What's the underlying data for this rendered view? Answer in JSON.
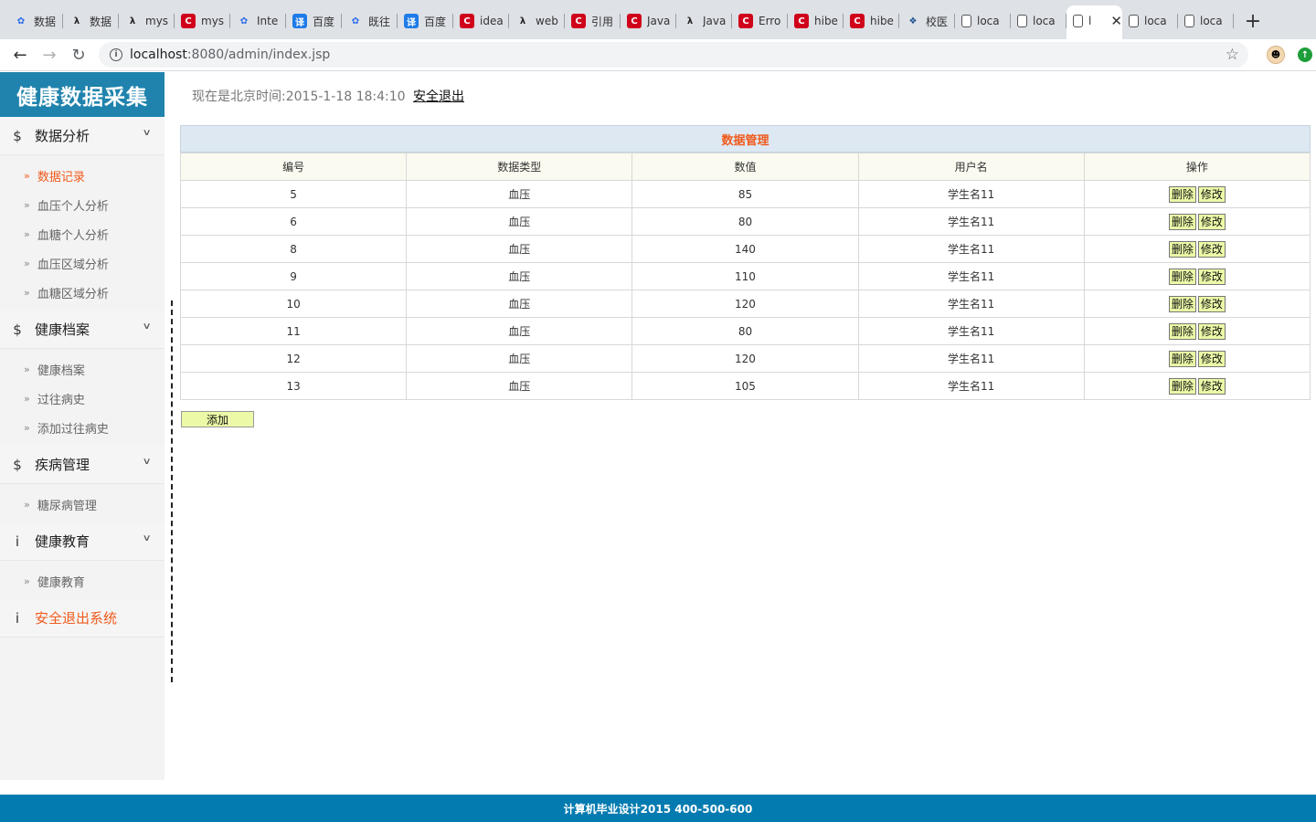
{
  "browser": {
    "tabs": [
      {
        "icon": "paw-icon",
        "title": "数据"
      },
      {
        "icon": "lambda-icon",
        "title": "数据"
      },
      {
        "icon": "lambda-icon",
        "title": "mys"
      },
      {
        "icon": "csdn-icon",
        "title": "mys"
      },
      {
        "icon": "paw-icon",
        "title": "Inte"
      },
      {
        "icon": "translate-icon",
        "title": "百度"
      },
      {
        "icon": "paw-icon",
        "title": "既往"
      },
      {
        "icon": "translate-icon",
        "title": "百度"
      },
      {
        "icon": "csdn-icon",
        "title": "idea"
      },
      {
        "icon": "lambda-icon",
        "title": "web"
      },
      {
        "icon": "csdn-icon",
        "title": "引用"
      },
      {
        "icon": "csdn-icon",
        "title": "Java"
      },
      {
        "icon": "lambda-icon",
        "title": "Java"
      },
      {
        "icon": "csdn-icon",
        "title": "Erro"
      },
      {
        "icon": "csdn-icon",
        "title": "hibe"
      },
      {
        "icon": "csdn-icon",
        "title": "hibe"
      },
      {
        "icon": "globe-icon",
        "title": "校医"
      },
      {
        "icon": "doc-icon",
        "title": "loca"
      },
      {
        "icon": "doc-icon",
        "title": "loca"
      },
      {
        "icon": "doc-icon",
        "title": "l",
        "active": true
      },
      {
        "icon": "doc-icon",
        "title": "loca"
      },
      {
        "icon": "doc-icon",
        "title": "loca"
      }
    ],
    "new_tab": "+",
    "url_host": "localhost",
    "url_rest": ":8080/admin/index.jsp"
  },
  "sidebar": {
    "logo": "健康数据采集",
    "groups": [
      {
        "icon": "$",
        "label": "数据分析",
        "items": [
          "数据记录",
          "血压个人分析",
          "血糖个人分析",
          "血压区域分析",
          "血糖区域分析"
        ]
      },
      {
        "icon": "$",
        "label": "健康档案",
        "items": [
          "健康档案",
          "过往病史",
          "添加过往病史"
        ]
      },
      {
        "icon": "$",
        "label": "疾病管理",
        "items": [
          "糖尿病管理"
        ]
      },
      {
        "icon": "i",
        "label": "健康教育",
        "items": [
          "健康教育"
        ]
      }
    ],
    "exit": {
      "icon": "i",
      "label": "安全退出系统"
    }
  },
  "header": {
    "time_text": "现在是北京时间:2015-1-18 18:4:10",
    "logout": "安全退出"
  },
  "table": {
    "title": "数据管理",
    "columns": [
      "编号",
      "数据类型",
      "数值",
      "用户名",
      "操作"
    ],
    "rows": [
      [
        "5",
        "血压",
        "85",
        "学生名11"
      ],
      [
        "6",
        "血压",
        "80",
        "学生名11"
      ],
      [
        "8",
        "血压",
        "140",
        "学生名11"
      ],
      [
        "9",
        "血压",
        "110",
        "学生名11"
      ],
      [
        "10",
        "血压",
        "120",
        "学生名11"
      ],
      [
        "11",
        "血压",
        "80",
        "学生名11"
      ],
      [
        "12",
        "血压",
        "120",
        "学生名11"
      ],
      [
        "13",
        "血压",
        "105",
        "学生名11"
      ]
    ],
    "delete_label": "删除",
    "edit_label": "修改",
    "add_label": "添加"
  },
  "footer": {
    "text": "计算机毕业设计2015  400-500-600"
  },
  "colors": {
    "brand": "#1f83ad",
    "accent": "#f05a1c",
    "footer": "#037bb0",
    "button": "#ecf9a7"
  }
}
